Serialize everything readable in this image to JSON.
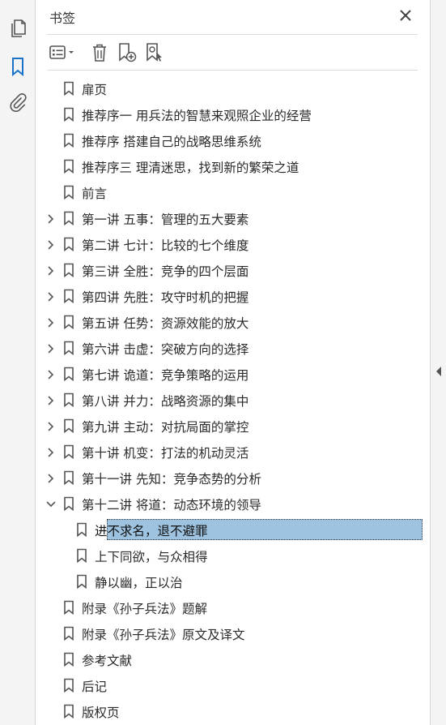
{
  "panel": {
    "title": "书签",
    "close_icon": "close-icon"
  },
  "rail": {
    "items": [
      {
        "name": "pages-icon"
      },
      {
        "name": "bookmarks-icon",
        "active": true
      },
      {
        "name": "attachments-icon"
      }
    ]
  },
  "toolbar": {
    "items": [
      "options-menu-icon",
      "delete-icon",
      "new-bookmark-icon",
      "new-bookmark-from-structure-icon"
    ]
  },
  "bookmarks": [
    {
      "label": "扉页",
      "level": 0,
      "expandable": false
    },
    {
      "label": "推荐序一 用兵法的智慧来观照企业的经营",
      "level": 0,
      "expandable": false
    },
    {
      "label": "推荐序 搭建自己的战略思维系统",
      "level": 0,
      "expandable": false
    },
    {
      "label": "推荐序三 理清迷思，找到新的繁荣之道",
      "level": 0,
      "expandable": false
    },
    {
      "label": "前言",
      "level": 0,
      "expandable": false
    },
    {
      "label": "第一讲 五事：管理的五大要素",
      "level": 0,
      "expandable": true,
      "expanded": false
    },
    {
      "label": "第二讲 七计：比较的七个维度",
      "level": 0,
      "expandable": true,
      "expanded": false
    },
    {
      "label": "第三讲 全胜：竞争的四个层面",
      "level": 0,
      "expandable": true,
      "expanded": false
    },
    {
      "label": "第四讲 先胜：攻守时机的把握",
      "level": 0,
      "expandable": true,
      "expanded": false
    },
    {
      "label": "第五讲 任势：资源效能的放大",
      "level": 0,
      "expandable": true,
      "expanded": false
    },
    {
      "label": "第六讲 击虚：突破方向的选择",
      "level": 0,
      "expandable": true,
      "expanded": false
    },
    {
      "label": "第七讲 诡道：竞争策略的运用",
      "level": 0,
      "expandable": true,
      "expanded": false
    },
    {
      "label": "第八讲 并力：战略资源的集中",
      "level": 0,
      "expandable": true,
      "expanded": false
    },
    {
      "label": "第九讲 主动：对抗局面的掌控",
      "level": 0,
      "expandable": true,
      "expanded": false
    },
    {
      "label": "第十讲 机变：打法的机动灵活",
      "level": 0,
      "expandable": true,
      "expanded": false
    },
    {
      "label": "第十一讲 先知：竞争态势的分析",
      "level": 0,
      "expandable": true,
      "expanded": false
    },
    {
      "label": "第十二讲 将道：动态环境的领导",
      "level": 0,
      "expandable": true,
      "expanded": true
    },
    {
      "label": "进不求名，退不避罪",
      "level": 1,
      "expandable": false,
      "selected": true
    },
    {
      "label": "上下同欲，与众相得",
      "level": 1,
      "expandable": false
    },
    {
      "label": "静以幽，正以治",
      "level": 1,
      "expandable": false
    },
    {
      "label": "附录《孙子兵法》题解",
      "level": 0,
      "expandable": false
    },
    {
      "label": "附录《孙子兵法》原文及译文",
      "level": 0,
      "expandable": false
    },
    {
      "label": "参考文献",
      "level": 0,
      "expandable": false
    },
    {
      "label": "后记",
      "level": 0,
      "expandable": false
    },
    {
      "label": "版权页",
      "level": 0,
      "expandable": false
    }
  ],
  "colors": {
    "accent": "#1a73c8",
    "selection": "#9dc3e0",
    "icon": "#555555"
  }
}
